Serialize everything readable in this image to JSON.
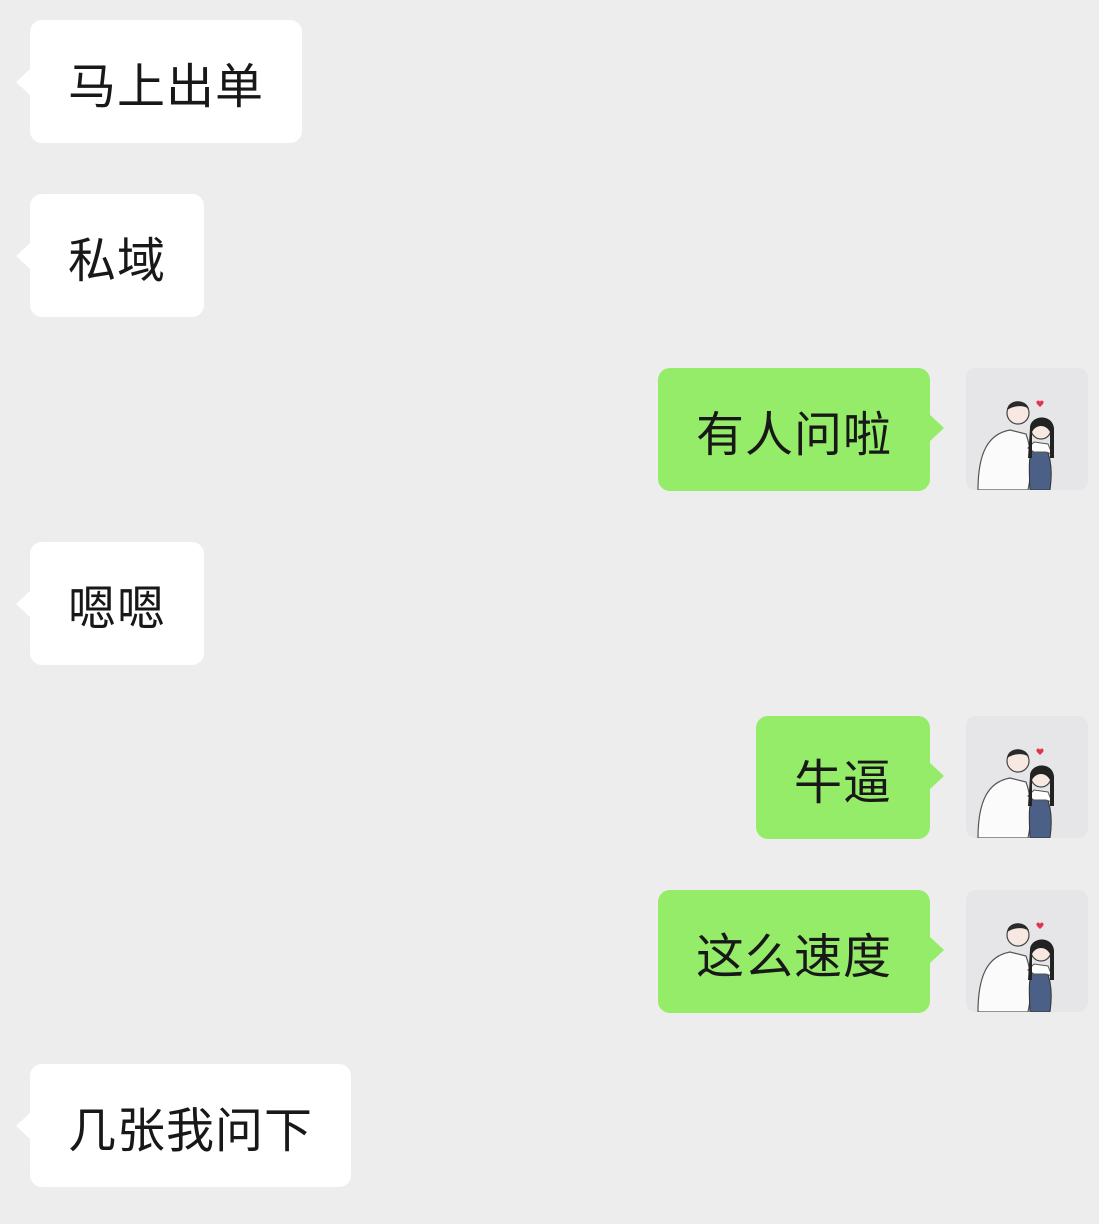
{
  "chat": {
    "messages": [
      {
        "side": "in",
        "text": "马上出单"
      },
      {
        "side": "in",
        "text": "私域"
      },
      {
        "side": "out",
        "text": "有人问啦",
        "avatar_icon": "couple-avatar-icon"
      },
      {
        "side": "in",
        "text": "嗯嗯"
      },
      {
        "side": "out",
        "text": "牛逼",
        "avatar_icon": "couple-avatar-icon"
      },
      {
        "side": "out",
        "text": "这么速度",
        "avatar_icon": "couple-avatar-icon"
      },
      {
        "side": "in",
        "text": "几张我问下"
      }
    ]
  },
  "colors": {
    "background": "#ededed",
    "incoming_bubble": "#ffffff",
    "outgoing_bubble": "#95ec69",
    "text": "#181818"
  }
}
